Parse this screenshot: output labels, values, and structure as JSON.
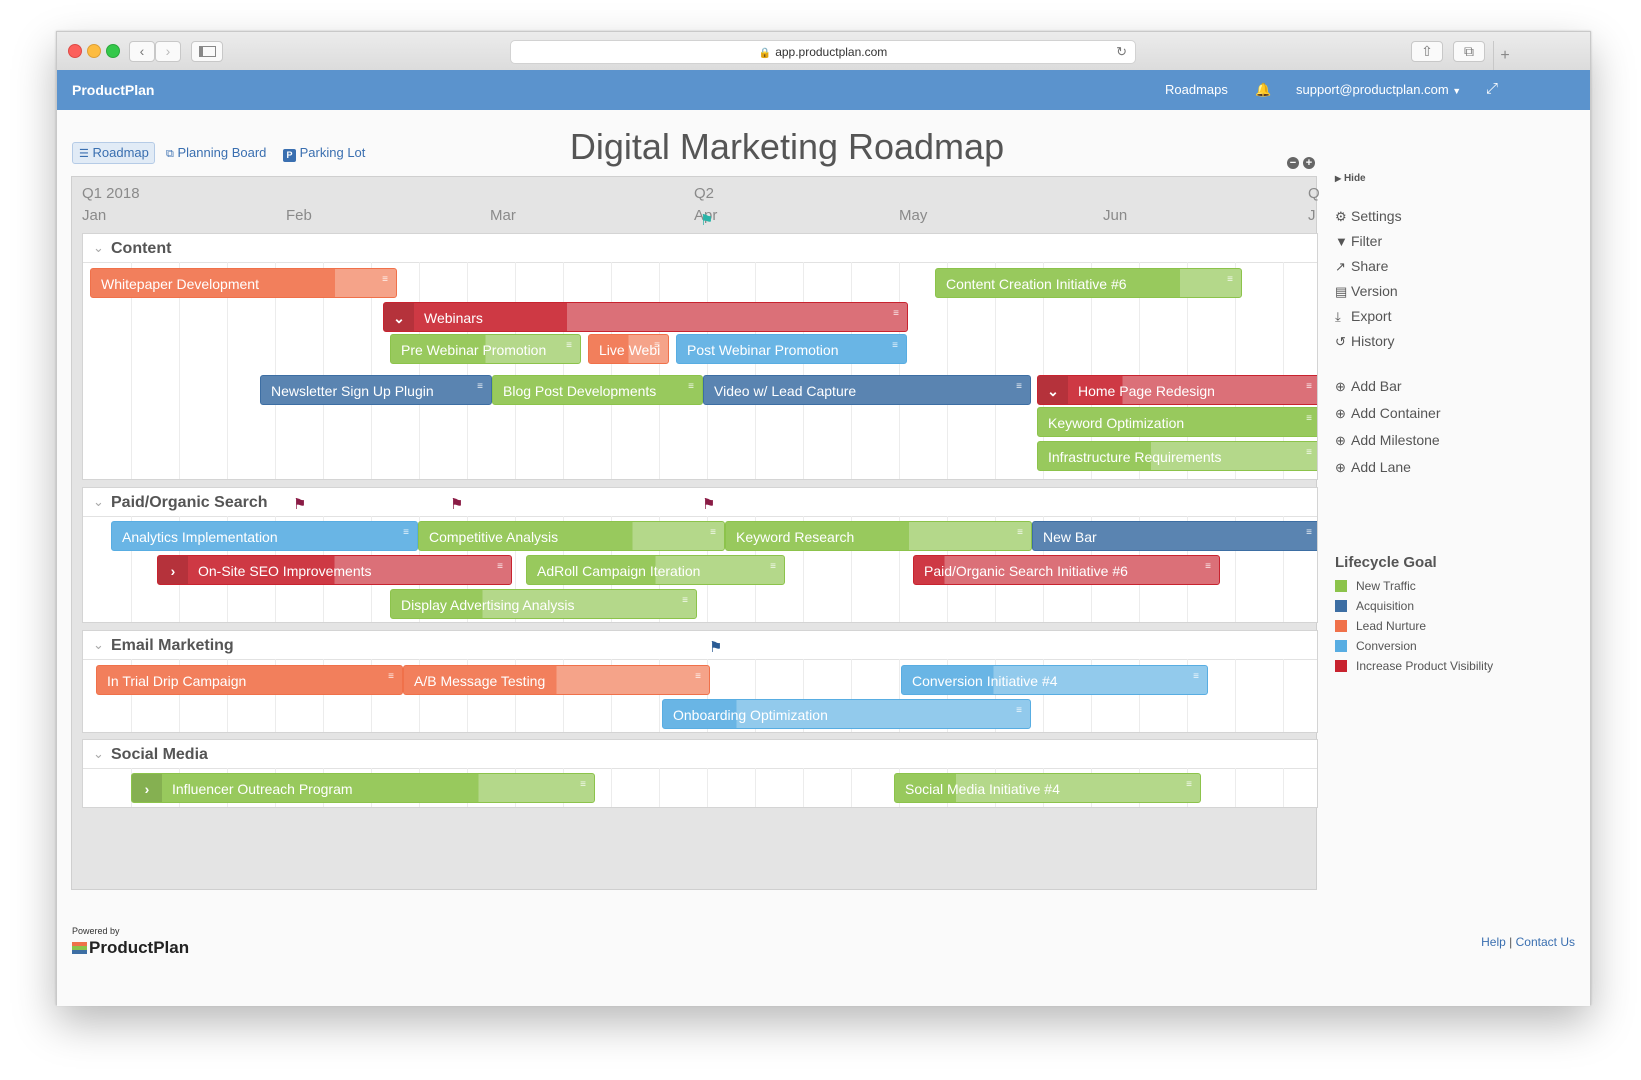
{
  "browser": {
    "url": "app.productplan.com"
  },
  "app": {
    "brand": "ProductPlan",
    "nav_roadmaps": "Roadmaps",
    "user_menu": "support@productplan.com"
  },
  "view_tabs": {
    "roadmap": "Roadmap",
    "planning_board": "Planning Board",
    "parking_lot": "Parking Lot"
  },
  "title": "Digital Marketing Roadmap",
  "timeline": {
    "quarters": [
      {
        "label": "Q1 2018"
      },
      {
        "label": "Q2"
      },
      {
        "label": "Q"
      }
    ],
    "months": [
      "Jan",
      "Feb",
      "Mar",
      "Apr",
      "May",
      "Jun",
      "J"
    ]
  },
  "lanes": [
    {
      "name": "Content"
    },
    {
      "name": "Paid/Organic Search"
    },
    {
      "name": "Email Marketing"
    },
    {
      "name": "Social Media"
    }
  ],
  "bars": [
    {
      "label": "Whitepaper Development",
      "goal": "Lead Nurture",
      "progress": 0.8
    },
    {
      "label": "Content Creation Initiative #6",
      "goal": "New Traffic",
      "progress": 0.8
    },
    {
      "label": "Webinars",
      "goal": "Increase Product Visibility",
      "progress": 0.35
    },
    {
      "label": "Pre Webinar Promotion",
      "goal": "New Traffic",
      "progress": 0.5
    },
    {
      "label": "Live Webi",
      "goal": "Lead Nurture",
      "progress": 0.5
    },
    {
      "label": "Post Webinar Promotion",
      "goal": "Conversion",
      "progress": 1.0
    },
    {
      "label": "Newsletter Sign Up Plugin",
      "goal": "Acquisition",
      "progress": 1.0
    },
    {
      "label": "Blog Post Developments",
      "goal": "New Traffic",
      "progress": 1.0
    },
    {
      "label": "Video w/ Lead Capture",
      "goal": "Acquisition",
      "progress": 1.0
    },
    {
      "label": "Home Page Redesign",
      "goal": "Increase Product Visibility",
      "progress": 0.3
    },
    {
      "label": "Keyword Optimization",
      "goal": "New Traffic",
      "progress": 1.0
    },
    {
      "label": "Infrastructure Requirements",
      "goal": "New Traffic",
      "progress": 0.4
    },
    {
      "label": "Analytics Implementation",
      "goal": "Conversion",
      "progress": 1.0
    },
    {
      "label": "Competitive Analysis",
      "goal": "New Traffic",
      "progress": 0.7
    },
    {
      "label": "Keyword Research",
      "goal": "New Traffic",
      "progress": 0.6
    },
    {
      "label": "New Bar",
      "goal": "Acquisition",
      "progress": 1.0
    },
    {
      "label": "On-Site SEO Improvements",
      "goal": "Increase Product Visibility",
      "progress": 0.5
    },
    {
      "label": "AdRoll Campaign Iteration",
      "goal": "New Traffic",
      "progress": 0.5
    },
    {
      "label": "Paid/Organic Search Initiative #6",
      "goal": "Increase Product Visibility",
      "progress": 0.1
    },
    {
      "label": "Display Advertising Analysis",
      "goal": "New Traffic",
      "progress": 0.3
    },
    {
      "label": "In Trial Drip Campaign",
      "goal": "Lead Nurture",
      "progress": 1.0
    },
    {
      "label": "A/B Message Testing",
      "goal": "Lead Nurture",
      "progress": 0.5
    },
    {
      "label": "Conversion Initiative #4",
      "goal": "Conversion",
      "progress": 0.3
    },
    {
      "label": "Onboarding Optimization",
      "goal": "Conversion",
      "progress": 0.2
    },
    {
      "label": "Influencer Outreach Program",
      "goal": "New Traffic",
      "progress": 0.75
    },
    {
      "label": "Social Media Initiative #4",
      "goal": "New Traffic",
      "progress": 0.2
    }
  ],
  "side": {
    "hide": "Hide",
    "settings": "Settings",
    "filter": "Filter",
    "share": "Share",
    "version": "Version",
    "export": "Export",
    "history": "History",
    "add_bar": "Add Bar",
    "add_container": "Add Container",
    "add_milestone": "Add Milestone",
    "add_lane": "Add Lane"
  },
  "legend": {
    "title": "Lifecycle Goal",
    "items": [
      {
        "label": "New Traffic",
        "color": "#8cc34b"
      },
      {
        "label": "Acquisition",
        "color": "#3d6ea3"
      },
      {
        "label": "Lead Nurture",
        "color": "#f0714a"
      },
      {
        "label": "Conversion",
        "color": "#58ade2"
      },
      {
        "label": "Increase Product Visibility",
        "color": "#c8232f"
      }
    ]
  },
  "footer": {
    "powered_by": "Powered by",
    "logo": "ProductPlan",
    "help": "Help",
    "separator": "|",
    "contact": "Contact Us"
  }
}
